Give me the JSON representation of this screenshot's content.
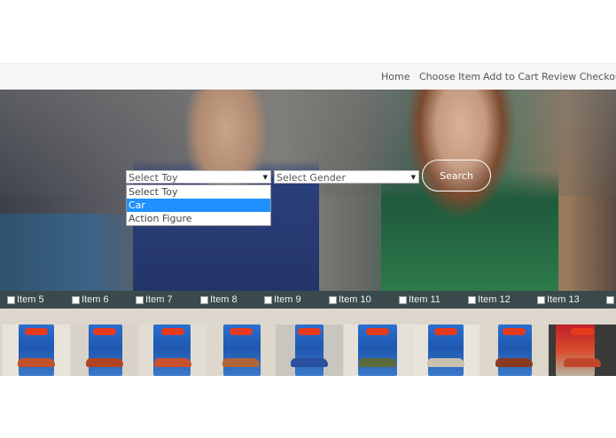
{
  "nav": {
    "items": [
      {
        "label": "Home"
      },
      {
        "label": "Choose Item"
      },
      {
        "label": "Add to Cart"
      },
      {
        "label": "Review Checkout"
      }
    ]
  },
  "search_form": {
    "toy_select": {
      "value": "Select Toy"
    },
    "gender_select": {
      "value": "Select Gender"
    },
    "toy_options": [
      {
        "label": "Select Toy",
        "highlighted": false
      },
      {
        "label": "Car",
        "highlighted": true
      },
      {
        "label": "Action Figure",
        "highlighted": false
      }
    ],
    "search_label": "Search"
  },
  "items": [
    {
      "label": "Item 5"
    },
    {
      "label": "Item 6"
    },
    {
      "label": "Item 7"
    },
    {
      "label": "Item 8"
    },
    {
      "label": "Item 9"
    },
    {
      "label": "Item 10"
    },
    {
      "label": "Item 11"
    },
    {
      "label": "Item 12"
    },
    {
      "label": "Item 13"
    },
    {
      "label": ""
    }
  ],
  "thumbnails": [
    {
      "car_color": "#c0532a"
    },
    {
      "car_color": "#b04422"
    },
    {
      "car_color": "#c8502c"
    },
    {
      "car_color": "#b0643a"
    },
    {
      "car_color": "#2a4fa0"
    },
    {
      "car_color": "#5a6a3a"
    },
    {
      "car_color": "#c8c2b0"
    },
    {
      "car_color": "#8a3a22"
    },
    {
      "car_color": "#c0462a"
    }
  ],
  "colors": {
    "highlight": "#1e90ff",
    "items_bar": "#3a4a4c",
    "navbar": "#f6f6f6"
  }
}
